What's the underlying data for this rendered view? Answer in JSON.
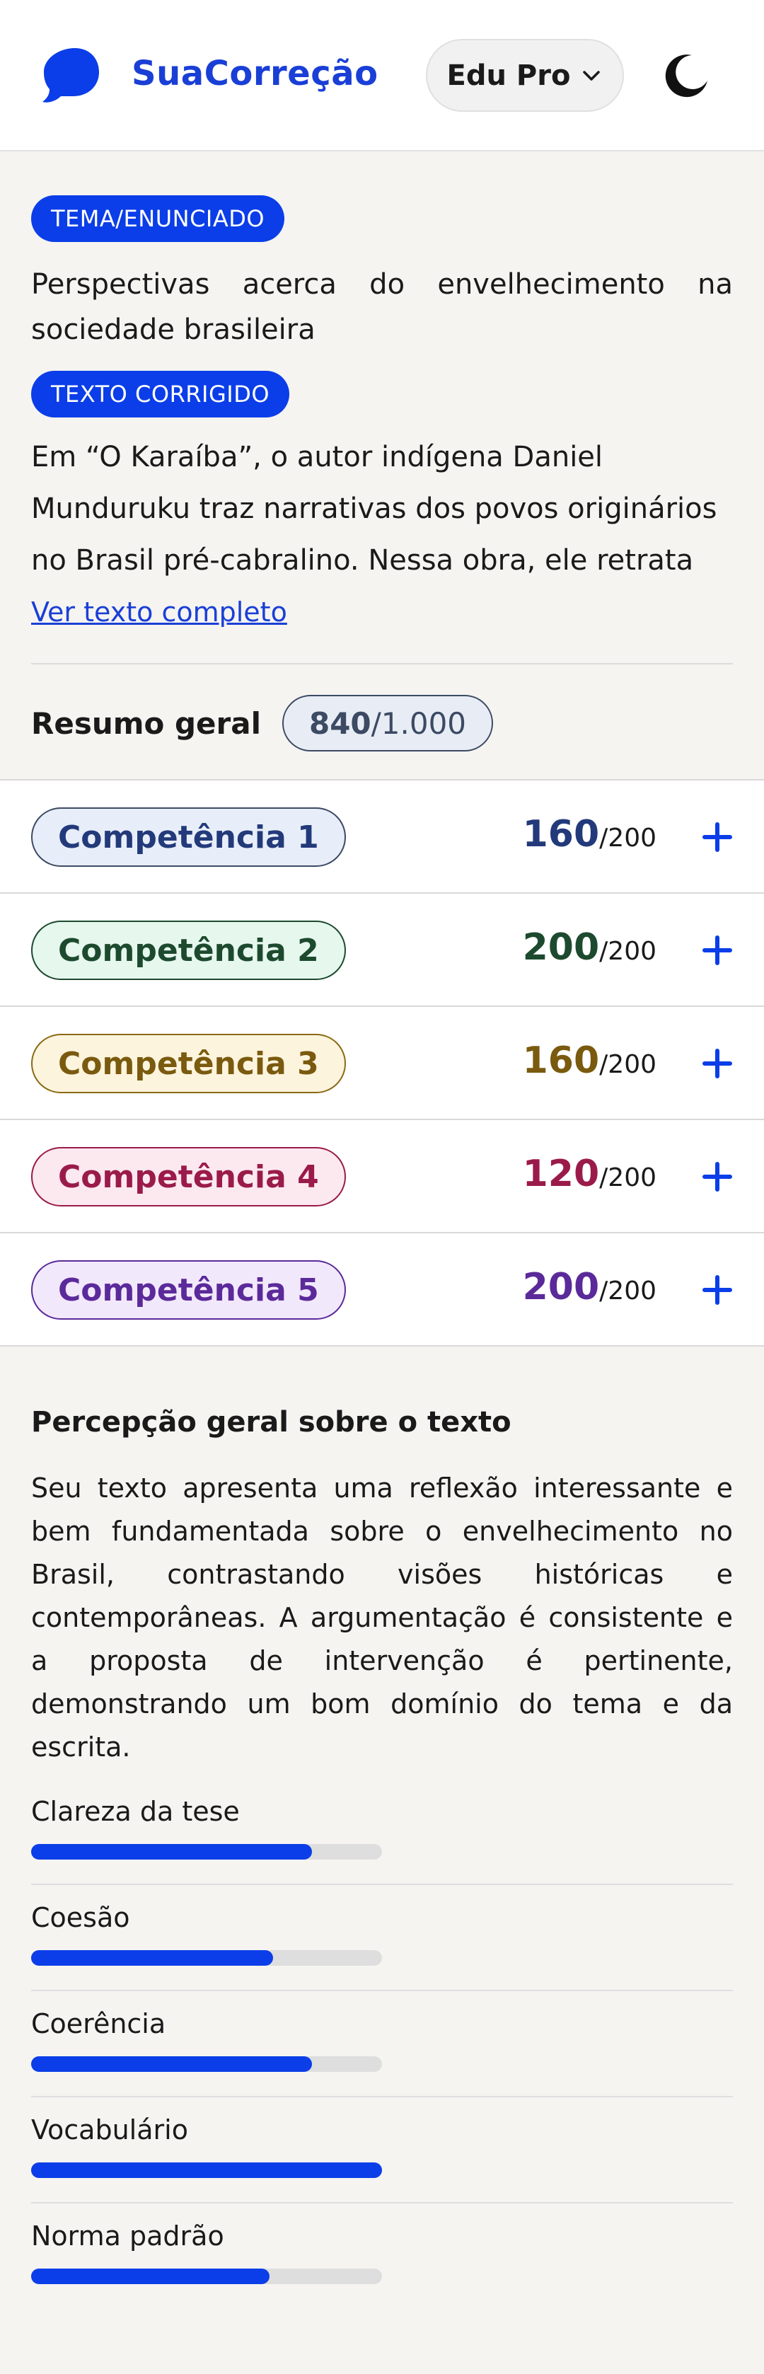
{
  "header": {
    "brand": "SuaCorreção",
    "plan_label": "Edu Pro"
  },
  "theme": {
    "tag": "TEMA/ENUNCIADO",
    "text": "Perspectivas acerca do envelhecimento na sociedade brasileira"
  },
  "essay": {
    "tag": "TEXTO CORRIGIDO",
    "text": "Em “O Karaíba”, o autor indígena Daniel Munduruku traz narrativas dos povos originários no Brasil pré-cabralino. Nessa obra, ele retrata",
    "link": "Ver texto completo"
  },
  "summary": {
    "label": "Resumo geral",
    "score": "840",
    "total": "/1.000"
  },
  "competencies": [
    {
      "label": "Competência 1",
      "score": "160",
      "max": "/200",
      "color": "#233a7a",
      "bg": "#e8eef9",
      "border": "#3c4a63"
    },
    {
      "label": "Competência 2",
      "score": "200",
      "max": "/200",
      "color": "#1d4a2e",
      "bg": "#e6f7ee",
      "border": "#1d4a2e"
    },
    {
      "label": "Competência 3",
      "score": "160",
      "max": "/200",
      "color": "#7a5a0e",
      "bg": "#fdf4de",
      "border": "#8a6a14"
    },
    {
      "label": "Competência 4",
      "score": "120",
      "max": "/200",
      "color": "#9a1b4a",
      "bg": "#fce9ef",
      "border": "#9a1b4a"
    },
    {
      "label": "Competência 5",
      "score": "200",
      "max": "/200",
      "color": "#5b2a9a",
      "bg": "#f2e8fb",
      "border": "#5b2a9a"
    }
  ],
  "perception": {
    "title": "Percepção geral sobre o texto",
    "text": "Seu texto apresenta uma reflexão interessante e bem fundamentada sobre o envelhecimento no Brasil, contrastando visões históricas e contemporâneas. A argumentação é consistente e a proposta de intervenção é pertinente, demonstrando um bom domínio do tema e da escrita.",
    "metrics": [
      {
        "label": "Clareza da tese",
        "level": 0.8
      },
      {
        "label": "Coesão",
        "level": 0.69
      },
      {
        "label": "Coerência",
        "level": 0.8
      },
      {
        "label": "Vocabulário",
        "level": 1.0
      },
      {
        "label": "Norma padrão",
        "level": 0.68
      }
    ]
  },
  "colors": {
    "accent": "#0b3ee8",
    "brand": "#1a3fd6"
  },
  "icons": {
    "logo": "speech-bubble-icon",
    "plan_dropdown": "chevron-down-icon",
    "theme_toggle": "moon-icon",
    "expand": "plus-icon"
  }
}
